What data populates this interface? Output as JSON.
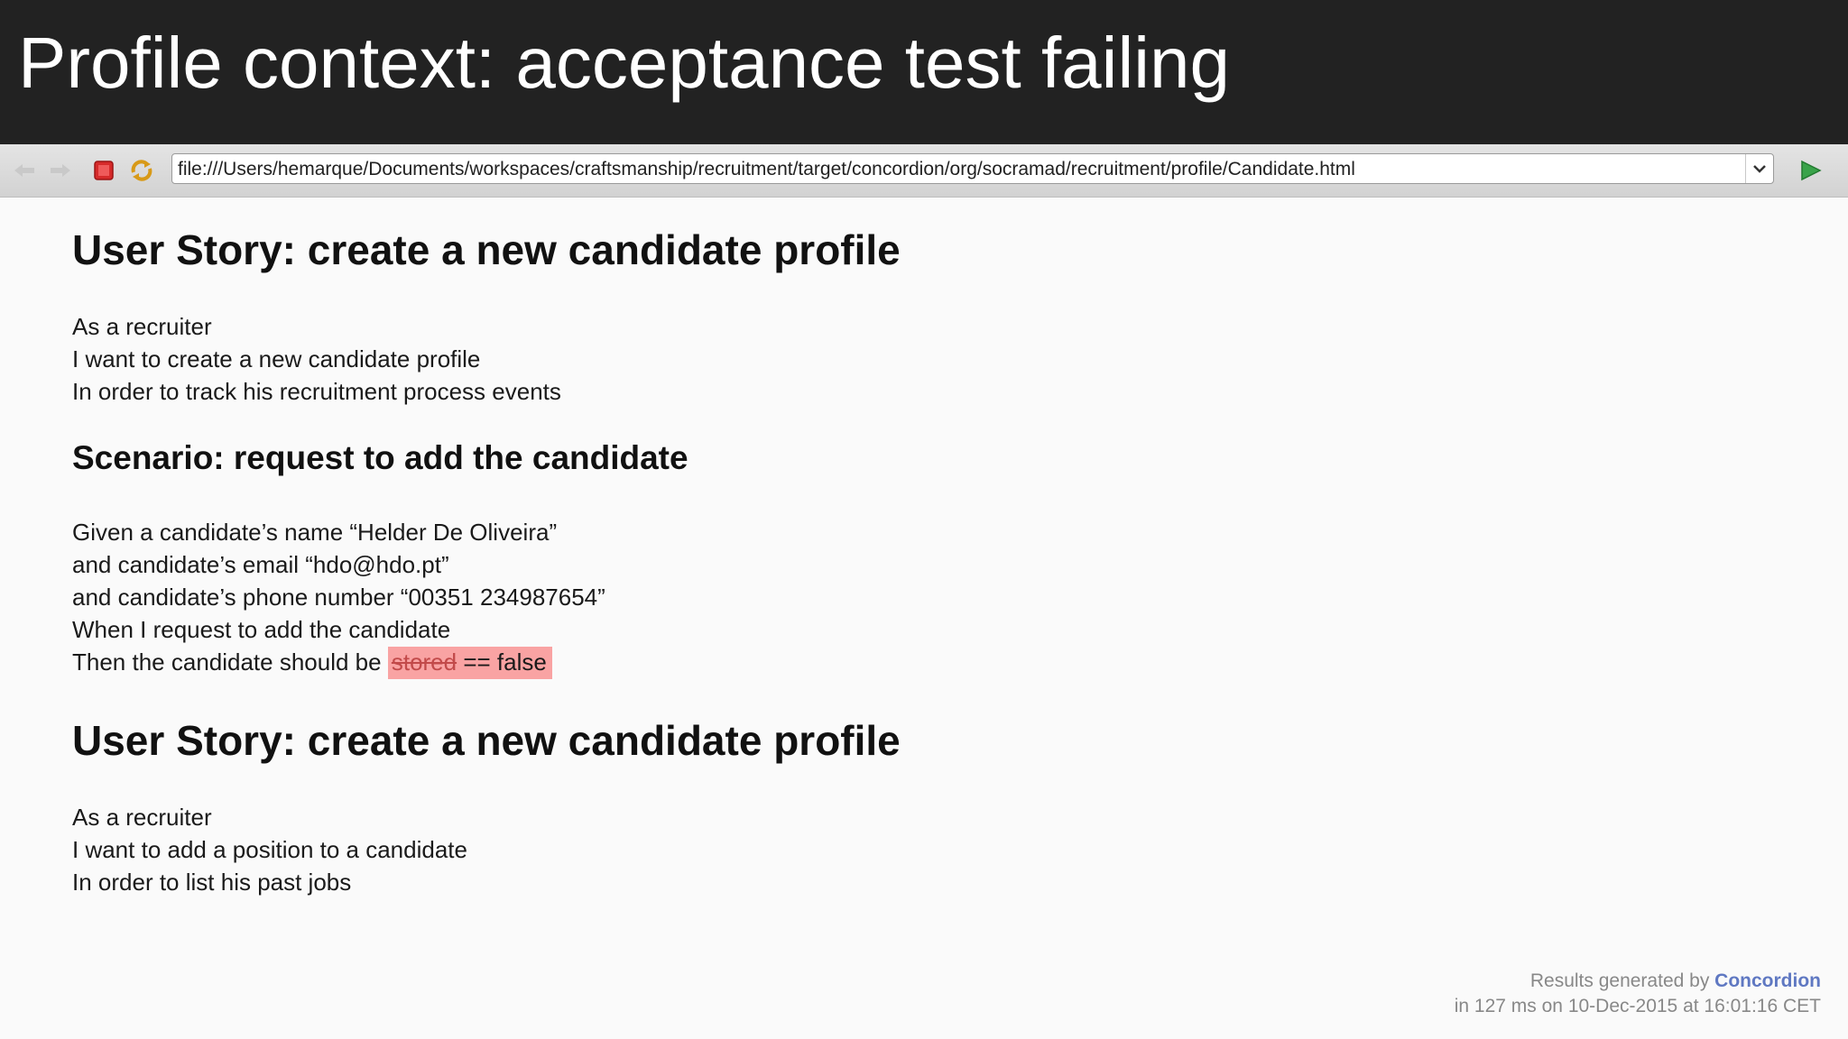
{
  "slide": {
    "title": "Profile context: acceptance test failing"
  },
  "browser": {
    "address": "file:///Users/hemarque/Documents/workspaces/craftsmanship/recruitment/target/concordion/org/socramad/recruitment/profile/Candidate.html",
    "icons": {
      "back": "arrow-left-icon",
      "forward": "arrow-right-icon",
      "stop": "stop-icon",
      "refresh": "refresh-icon",
      "dropdown": "chevron-down-icon",
      "go": "play-icon"
    }
  },
  "story1": {
    "title": "User Story: create a new candidate profile",
    "lines": [
      "As a recruiter",
      "I want to create a new candidate profile",
      "In order to track his recruitment process events"
    ]
  },
  "scenario": {
    "title": "Scenario: request to add the candidate",
    "lines": [
      "Given a candidate’s name “Helder De Oliveira”",
      "and candidate’s email “hdo@hdo.pt”",
      "and candidate’s phone number “00351 234987654”",
      "When I request to add the candidate"
    ],
    "then_prefix": "Then the candidate should be",
    "expected": "stored",
    "actual": "== false"
  },
  "story2": {
    "title": "User Story: create a new candidate profile",
    "lines": [
      "As a recruiter",
      "I want to add a position to a candidate",
      "In order to list his past jobs"
    ]
  },
  "footer": {
    "generated_by": "Results generated by",
    "brand": "Concordion",
    "timing": "in 127 ms on 10-Dec-2015 at 16:01:16 CET"
  },
  "colors": {
    "header_bg": "#222222",
    "failure_bg": "#f9a3a3",
    "brand": "#5f78c2",
    "go_arrow": "#3aa34a",
    "stop_red": "#d62a2a"
  }
}
